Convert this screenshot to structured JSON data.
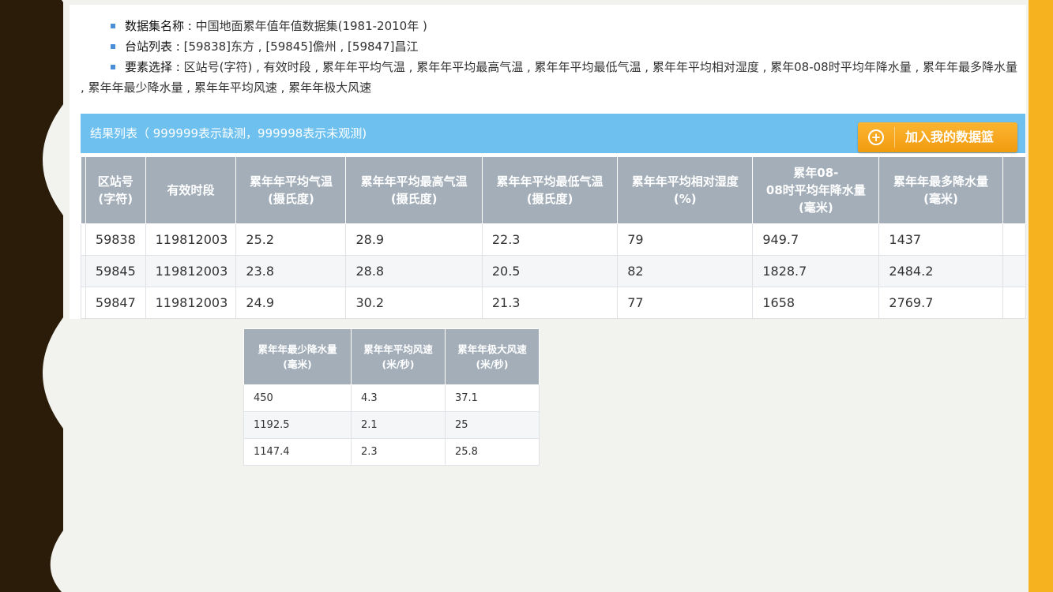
{
  "dataset": {
    "name_label": "数据集名称 :",
    "name_value": " 中国地面累年值年值数据集(1981-2010年 )",
    "stations_label": "台站列表 :",
    "stations_value": " [59838]东方 , [59845]儋州 , [59847]昌江",
    "elements_label": "要素选择 :",
    "elements_value": " 区站号(字符) , 有效时段 , 累年年平均气温 , 累年年平均最高气温 , 累年年平均最低气温 , 累年年平均相对湿度 , 累年08-08时平均年降水量 , 累年年最多降水量 , 累年年最少降水量 , 累年年平均风速 , 累年年极大风速"
  },
  "result": {
    "title": "结果列表（ 999999表示缺测，999998表示未观测)",
    "add_button": "加入我的数据篮",
    "add_icon": "plus-circle-icon"
  },
  "main_table": {
    "headers": [
      [
        "区站号",
        "(字符)"
      ],
      [
        "有效时段"
      ],
      [
        "累年年平均气温",
        "(摄氏度)"
      ],
      [
        "累年年平均最高气温",
        "(摄氏度)"
      ],
      [
        "累年年平均最低气温",
        "(摄氏度)"
      ],
      [
        "累年年平均相对湿度",
        "(%)"
      ],
      [
        "累年08-",
        "08时平均年降水量",
        "(毫米)"
      ],
      [
        "累年年最多降水量",
        "(毫米)"
      ]
    ],
    "rows": [
      [
        "59838",
        "119812003",
        "25.2",
        "28.9",
        "22.3",
        "79",
        "949.7",
        "1437"
      ],
      [
        "59845",
        "119812003",
        "23.8",
        "28.8",
        "20.5",
        "82",
        "1828.7",
        "2484.2"
      ],
      [
        "59847",
        "119812003",
        "24.9",
        "30.2",
        "21.3",
        "77",
        "1658",
        "2769.7"
      ]
    ]
  },
  "sub_table": {
    "headers": [
      [
        "累年年最少降水量",
        "(毫米)"
      ],
      [
        "累年年平均风速",
        "(米/秒)"
      ],
      [
        "累年年极大风速",
        "(米/秒)"
      ]
    ],
    "rows": [
      [
        "450",
        "4.3",
        "37.1"
      ],
      [
        "1192.5",
        "2.1",
        "25"
      ],
      [
        "1147.4",
        "2.3",
        "25.8"
      ]
    ]
  },
  "colors": {
    "left_band": "#2a1c09",
    "right_band": "#f7b21f",
    "result_bar": "#6ec1ef",
    "table_header": "#a3aeb9",
    "button": "#f7a51f"
  }
}
